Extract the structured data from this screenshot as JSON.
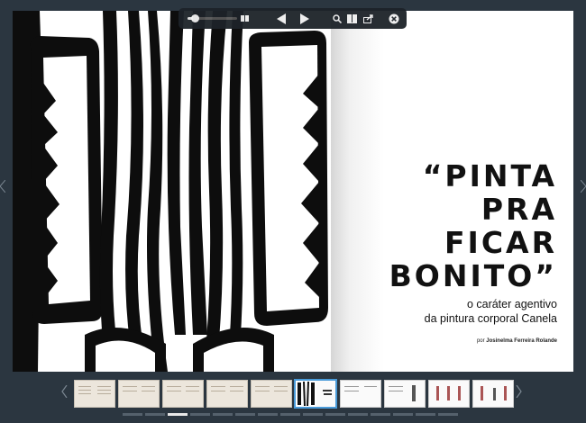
{
  "title": {
    "lines": [
      "“PINTA",
      "PRA",
      "FICAR",
      "BONITO”"
    ]
  },
  "subtitle": {
    "line1": "o caráter agentivo",
    "line2": "da pintura corporal Canela"
  },
  "author": {
    "prefix": "por",
    "name": "Josinelma Ferreira Rolande"
  },
  "toolbar": {
    "zoom_level": 0.15,
    "icons": [
      "zoom-slider",
      "grid-view-icon",
      "previous-arrow-icon",
      "next-arrow-icon",
      "search-icon",
      "bookmarks-icon",
      "share-icon",
      "close-icon"
    ]
  },
  "thumbnails": {
    "count": 10,
    "active_index": 5,
    "page_dots": 15,
    "active_dot": 2
  },
  "colors": {
    "background": "#2b3640",
    "toolbar": "#1d2329",
    "active_thumb": "#4a9bd9"
  }
}
